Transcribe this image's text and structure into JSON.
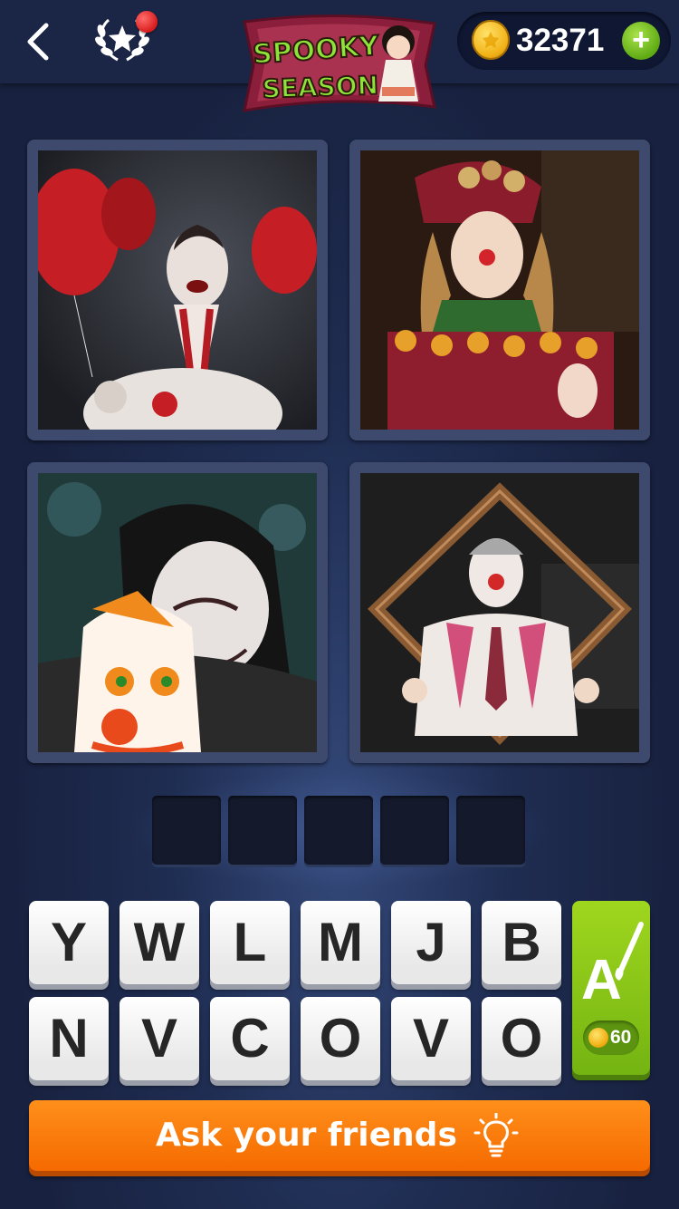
{
  "header": {
    "back_icon": "chevron-left-icon",
    "achievements_icon": "laurel-star-icon",
    "logo": {
      "line1": "SPOOKY",
      "line2": "SEASON"
    },
    "coins": {
      "value": "32371",
      "icon": "coin-icon",
      "add_icon": "plus-icon",
      "add_label": "+"
    }
  },
  "puzzle": {
    "pictures": [
      {
        "subject": "woman in clown makeup with red balloons"
      },
      {
        "subject": "clown doll with red and orange pompoms"
      },
      {
        "subject": "woman holding a clown mask"
      },
      {
        "subject": "clown holding an empty picture frame"
      }
    ],
    "answer_slots": [
      "",
      "",
      "",
      "",
      ""
    ]
  },
  "keyboard": {
    "row1": [
      "Y",
      "W",
      "L",
      "M",
      "J",
      "B"
    ],
    "row2": [
      "N",
      "V",
      "C",
      "O",
      "V",
      "O"
    ],
    "hint": {
      "icon": "letter-brush-icon",
      "cost": "60"
    }
  },
  "ask_button": {
    "label": "Ask your friends",
    "icon": "lightbulb-icon"
  },
  "colors": {
    "background": "#18213f",
    "ask_orange": "#f56a00",
    "hint_green": "#74b412",
    "coin_gold": "#f2b319"
  }
}
